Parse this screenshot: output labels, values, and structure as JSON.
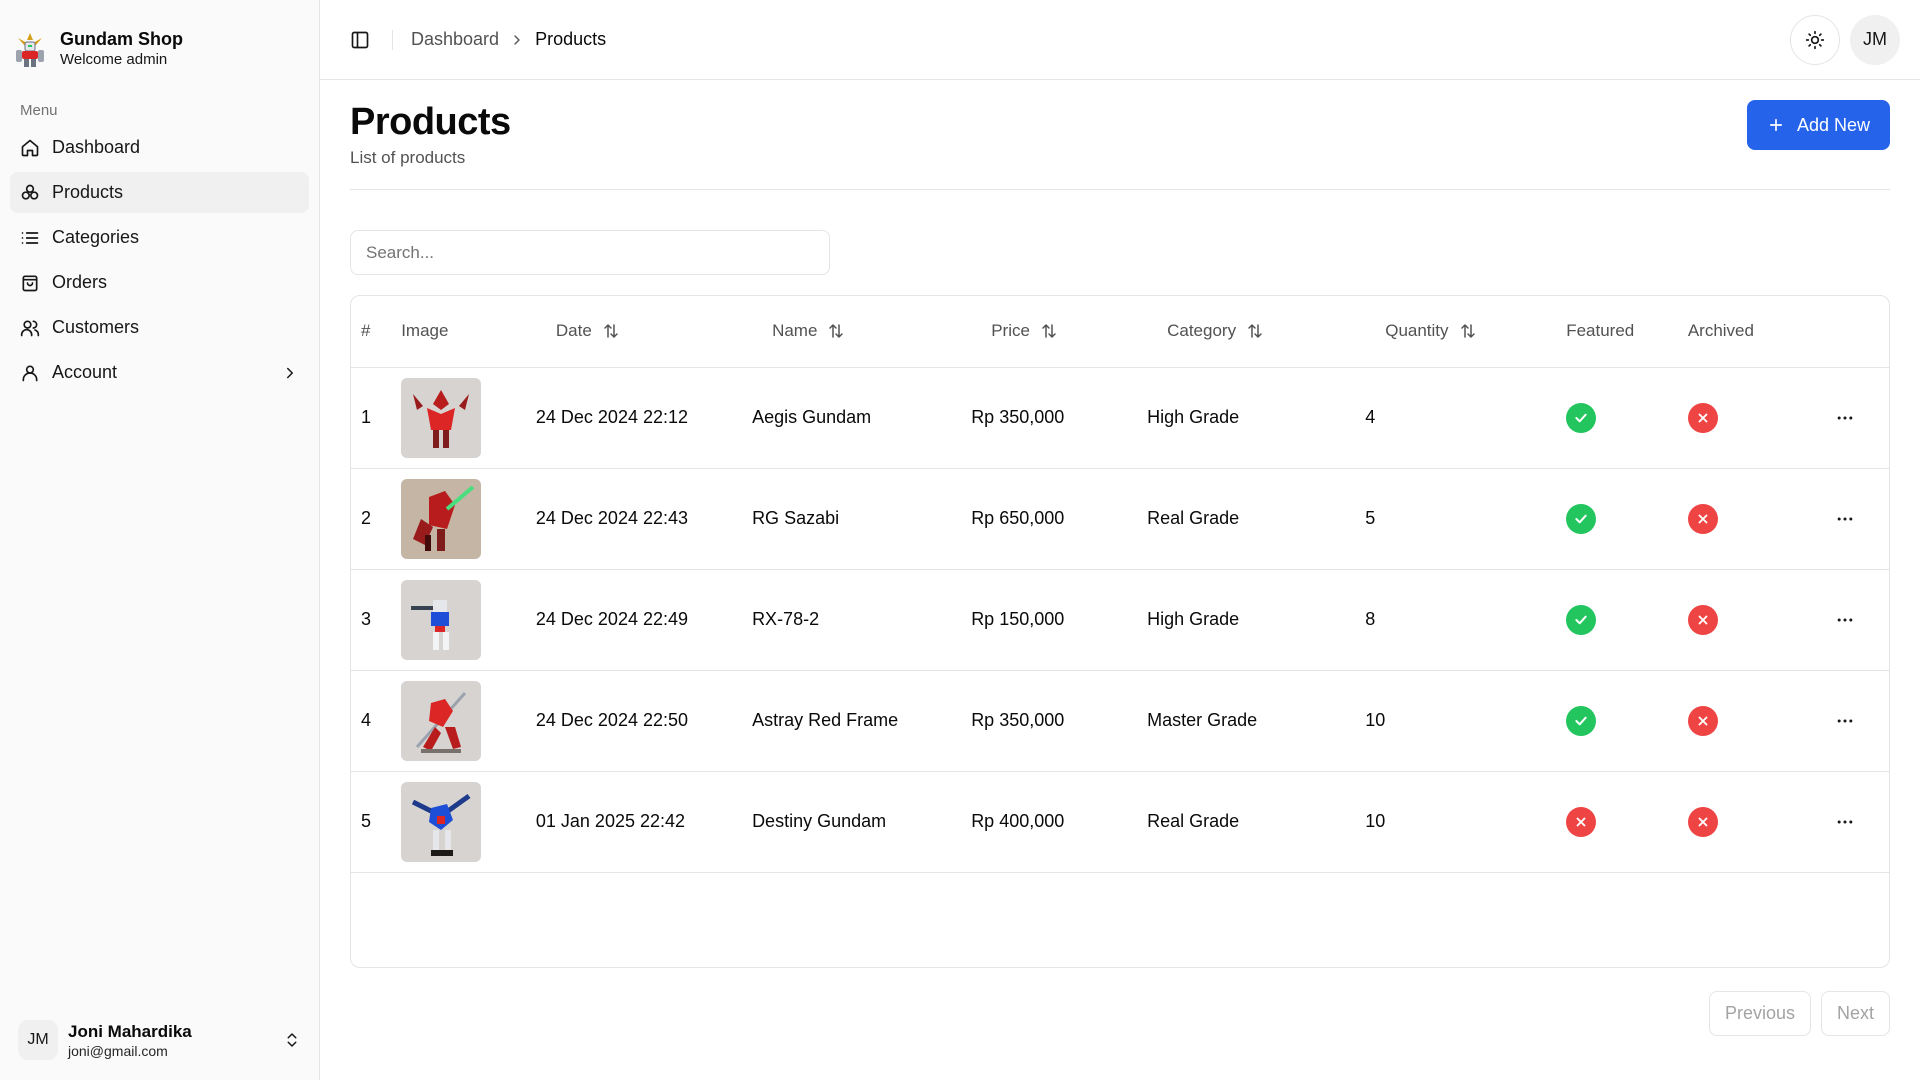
{
  "brand": {
    "name": "Gundam Shop",
    "welcome": "Welcome admin"
  },
  "sidebar": {
    "menu_label": "Menu",
    "items": [
      {
        "label": "Dashboard",
        "icon": "home-icon"
      },
      {
        "label": "Products",
        "icon": "products-icon",
        "active": true
      },
      {
        "label": "Categories",
        "icon": "list-icon"
      },
      {
        "label": "Orders",
        "icon": "bag-icon"
      },
      {
        "label": "Customers",
        "icon": "users-icon"
      },
      {
        "label": "Account",
        "icon": "user-icon",
        "has_submenu": true
      }
    ]
  },
  "user": {
    "initials": "JM",
    "name": "Joni Mahardika",
    "email": "joni@gmail.com"
  },
  "topbar": {
    "breadcrumb": [
      "Dashboard",
      "Products"
    ],
    "theme_icon": "sun-icon",
    "avatar_initials": "JM"
  },
  "page": {
    "title": "Products",
    "subtitle": "List of products",
    "add_button": "Add New"
  },
  "search": {
    "placeholder": "Search...",
    "value": ""
  },
  "table": {
    "columns": [
      "#",
      "Image",
      "Date",
      "Name",
      "Price",
      "Category",
      "Quantity",
      "Featured",
      "Archived"
    ],
    "rows": [
      {
        "no": "1",
        "date": "24 Dec 2024 22:12",
        "name": "Aegis Gundam",
        "price": "Rp 350,000",
        "category": "High Grade",
        "quantity": "4",
        "featured": true,
        "archived": false
      },
      {
        "no": "2",
        "date": "24 Dec 2024 22:43",
        "name": "RG Sazabi",
        "price": "Rp 650,000",
        "category": "Real Grade",
        "quantity": "5",
        "featured": true,
        "archived": false
      },
      {
        "no": "3",
        "date": "24 Dec 2024 22:49",
        "name": "RX-78-2",
        "price": "Rp 150,000",
        "category": "High Grade",
        "quantity": "8",
        "featured": true,
        "archived": false
      },
      {
        "no": "4",
        "date": "24 Dec 2024 22:50",
        "name": "Astray Red Frame",
        "price": "Rp 350,000",
        "category": "Master Grade",
        "quantity": "10",
        "featured": true,
        "archived": false
      },
      {
        "no": "5",
        "date": "01 Jan 2025 22:42",
        "name": "Destiny Gundam",
        "price": "Rp 400,000",
        "category": "Real Grade",
        "quantity": "10",
        "featured": false,
        "archived": false
      }
    ]
  },
  "pagination": {
    "previous": "Previous",
    "next": "Next"
  },
  "colors": {
    "accent": "#2563eb",
    "success": "#22c55e",
    "danger": "#ef4444"
  }
}
